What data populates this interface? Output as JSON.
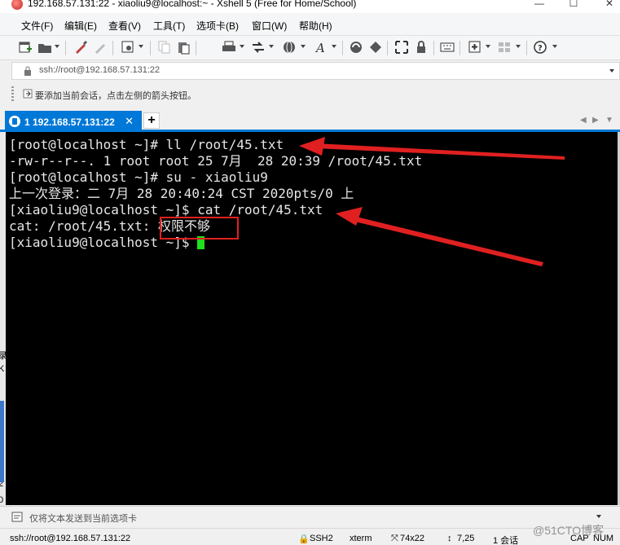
{
  "window": {
    "title": "192.168.57.131:22 - xiaoliu9@localhost:~ - Xshell 5 (Free for Home/School)",
    "controls": [
      "—",
      "☐",
      "✕"
    ]
  },
  "menu": [
    "文件(F)",
    "编辑(E)",
    "查看(V)",
    "工具(T)",
    "选项卡(B)",
    "窗口(W)",
    "帮助(H)"
  ],
  "toolbar": {
    "icons": [
      "new-session-icon",
      "open-folder-icon",
      "reconnect-icon",
      "disconnect-icon",
      "properties-icon",
      "copy-icon",
      "paste-icon",
      "print-icon",
      "transfer-icon",
      "globe-icon",
      "font-icon",
      "xftp-icon",
      "xmanager-icon",
      "fullscreen-icon",
      "lock-icon",
      "keyboard-icon",
      "compose-icon",
      "layout-icon",
      "help-icon"
    ]
  },
  "address": {
    "value": "ssh://root@192.168.57.131:22"
  },
  "hint": {
    "text": "要添加当前会话，点击左侧的箭头按钮。"
  },
  "tabs": {
    "active_label": "1 192.168.57.131:22",
    "close": "✕",
    "add": "+",
    "nav_prev": "◀",
    "nav_next": "▶",
    "nav_menu": "▼"
  },
  "left_fragments": [
    "录",
    "K",
    "2",
    "0",
    "2",
    "0"
  ],
  "terminal": {
    "lines": [
      "[root@localhost ~]# ll /root/45.txt",
      "-rw-r--r--. 1 root root 25 7月  28 20:39 /root/45.txt",
      "[root@localhost ~]# su - xiaoliu9",
      "上一次登录：二 7月 28 20:40:24 CST 2020pts/0 上",
      "[xiaoliu9@localhost ~]$ cat /root/45.txt",
      "cat: /root/45.txt: 权限不够",
      "[xiaoliu9@localhost ~]$ "
    ],
    "highlighted_text": "权限不够",
    "accent_colors": {
      "arrow": "#e02020",
      "cursor": "#20e020"
    }
  },
  "sendbar": {
    "placeholder": "仅将文本发送到当前选项卡"
  },
  "status": {
    "connection": "ssh://root@192.168.57.131:22",
    "protocol": "SSH2",
    "terminal": "xterm",
    "size": "74x22",
    "cursor_pos": "7,25",
    "sessions": "1 会话",
    "caps": "CAP",
    "num": "NUM"
  },
  "watermark": "@51CTO博客"
}
